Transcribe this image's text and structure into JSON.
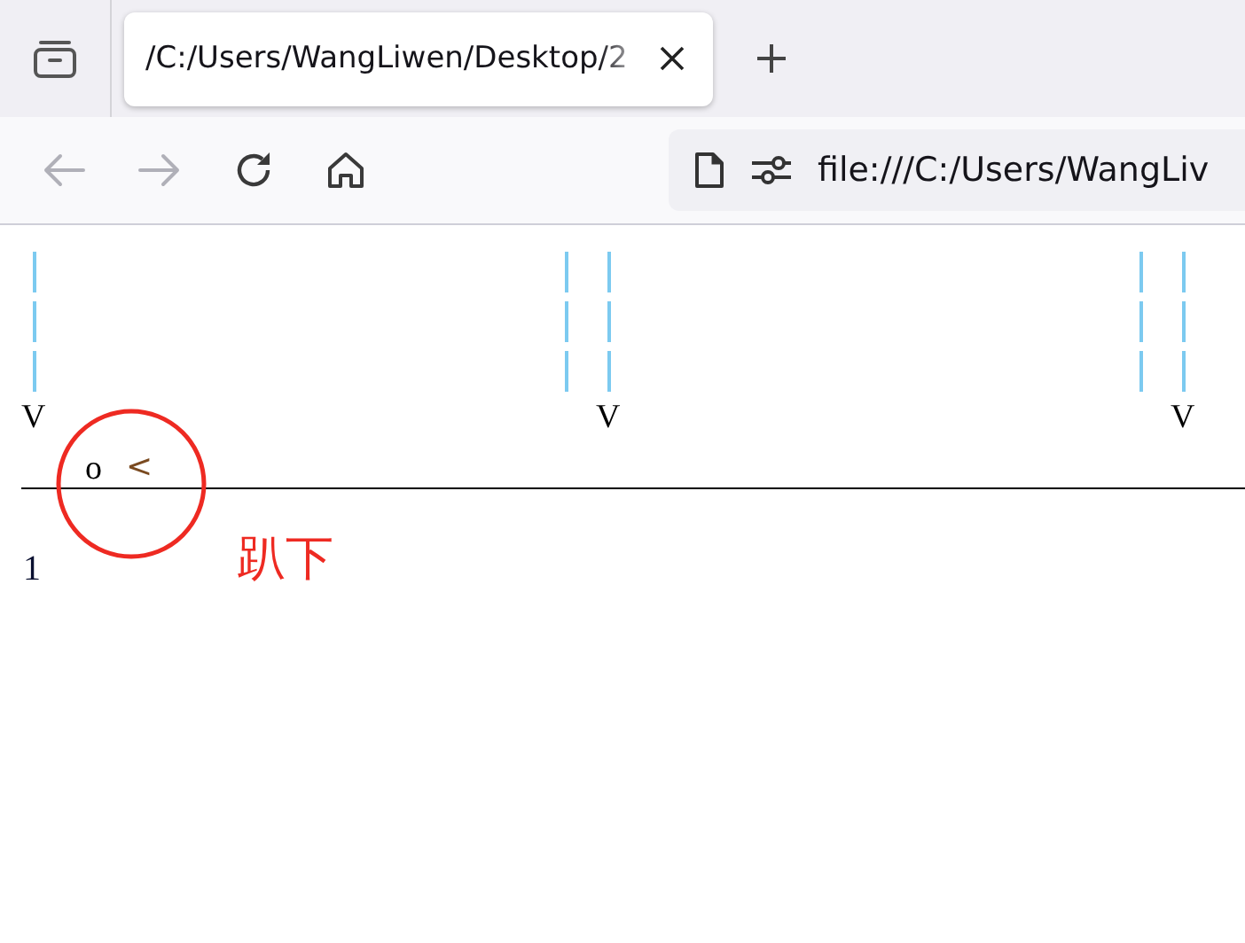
{
  "tabs": [
    {
      "title": "/C:/Users/WangLiwen/Desktop/2",
      "selected": true
    }
  ],
  "toolbar": {
    "back": {
      "disabled": true
    },
    "forward": {
      "disabled": true
    },
    "url": "file:///C:/Users/WangLiv"
  },
  "page": {
    "drops": [
      {
        "label": "V"
      },
      {
        "label": "V"
      },
      {
        "label": "V"
      }
    ],
    "figure": {
      "head": "o",
      "legs": "<"
    },
    "annotation": "趴下",
    "line_number": "1"
  }
}
